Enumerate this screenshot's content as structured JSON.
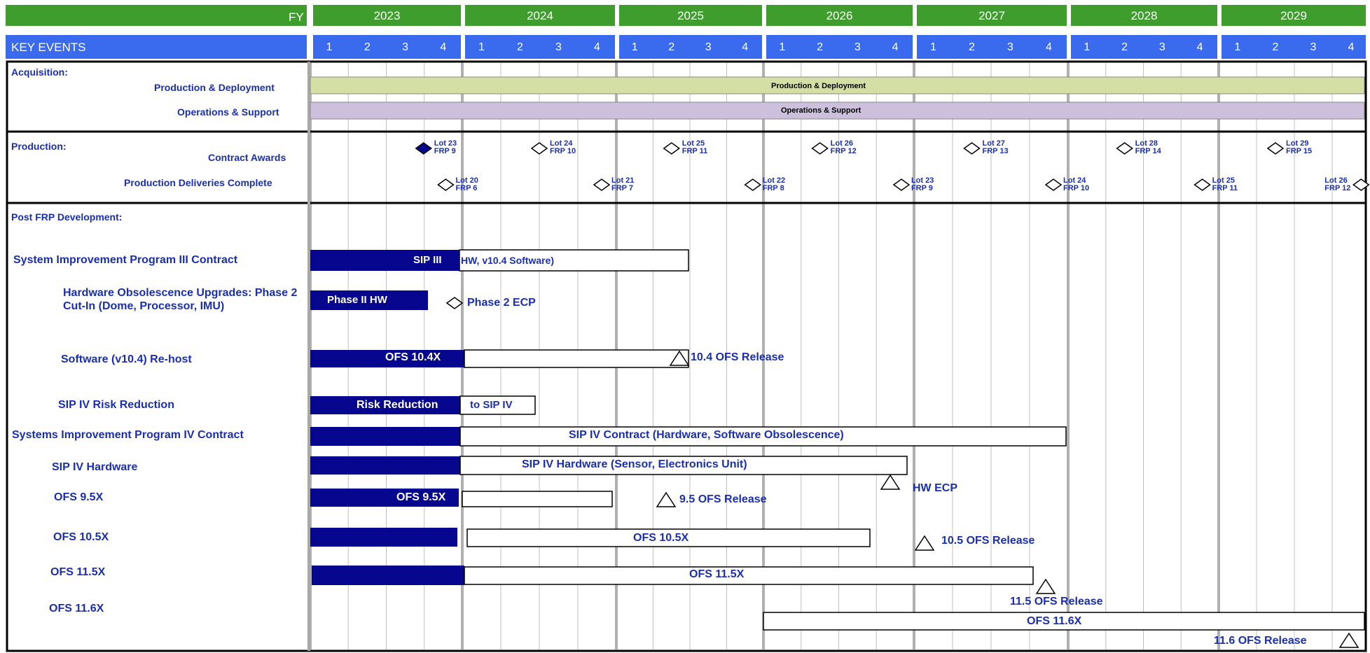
{
  "header": {
    "fy_label": "FY",
    "key_events_label": "KEY EVENTS",
    "years": [
      "2023",
      "2024",
      "2025",
      "2026",
      "2027",
      "2028",
      "2029"
    ],
    "quarters": [
      "1",
      "2",
      "3",
      "4"
    ]
  },
  "colors": {
    "header_green": "#3f9d2e",
    "header_blue": "#3a6bef",
    "navy": "#06068f",
    "text_blue": "#1a2fb0",
    "production_bar": "#d4dfa5",
    "ops_bar": "#ccc0dc",
    "grid_gray": "#c0c0c0"
  },
  "sections": {
    "acquisition": "Acquisition:",
    "production": "Production:",
    "post_frp": "Post FRP Development:"
  },
  "acquisition": {
    "production_deployment_label": "Production & Deployment",
    "production_deployment_bar": "Production & Deployment",
    "operations_support_label": "Operations & Support",
    "operations_support_bar": "Operations & Support"
  },
  "production": {
    "contract_awards_label": "Contract Awards",
    "deliveries_label": "Production Deliveries Complete",
    "awards": [
      {
        "lot": "Lot 23",
        "frp": "FRP 9",
        "filled": true
      },
      {
        "lot": "Lot 24",
        "frp": "FRP 10",
        "filled": false
      },
      {
        "lot": "Lot 25",
        "frp": "FRP 11",
        "filled": false
      },
      {
        "lot": "Lot 26",
        "frp": "FRP 12",
        "filled": false
      },
      {
        "lot": "Lot 27",
        "frp": "FRP 13",
        "filled": false
      },
      {
        "lot": "Lot 28",
        "frp": "FRP 14",
        "filled": false
      },
      {
        "lot": "Lot 29",
        "frp": "FRP 15",
        "filled": false
      }
    ],
    "deliveries": [
      {
        "lot": "Lot 20",
        "frp": "FRP 6"
      },
      {
        "lot": "Lot 21",
        "frp": "FRP 7"
      },
      {
        "lot": "Lot 22",
        "frp": "FRP 8"
      },
      {
        "lot": "Lot 23",
        "frp": "FRP 9"
      },
      {
        "lot": "Lot 24",
        "frp": "FRP 10"
      },
      {
        "lot": "Lot 25",
        "frp": "FRP 11"
      },
      {
        "lot": "Lot 26",
        "frp": "FRP 12"
      }
    ]
  },
  "rows": {
    "sip3_label": "System Improvement Program III Contract",
    "sip3_bar": "SIP III",
    "sip3_bar_rest": "HW, v10.4 Software)",
    "hw_obs_label": "Hardware Obsolescence Upgrades: Phase 2 Cut-In (Dome, Processor, IMU)",
    "hw_obs_bar": "Phase II HW",
    "hw_obs_milestone": "Phase 2 ECP",
    "sw_rehost_label": "Software (v10.4) Re-host",
    "sw_rehost_bar": "OFS 10.4X",
    "sw_rehost_milestone": "10.4 OFS Release",
    "sip4_risk_label": "SIP IV Risk Reduction",
    "sip4_risk_bar": "Risk Reduction",
    "sip4_risk_bar_rest": "to SIP IV",
    "sip4_contract_label": "Systems Improvement Program IV Contract",
    "sip4_contract_bar": "SIP IV Contract (Hardware, Software Obsolescence)",
    "sip4_hw_label": "SIP IV Hardware",
    "sip4_hw_bar": "SIP IV Hardware (Sensor, Electronics Unit)",
    "sip4_hw_milestone": "HW ECP",
    "ofs95_label": "OFS 9.5X",
    "ofs95_bar": "OFS 9.5X",
    "ofs95_milestone": "9.5 OFS Release",
    "ofs105_label": "OFS 10.5X",
    "ofs105_bar": "OFS 10.5X",
    "ofs105_milestone": "10.5 OFS Release",
    "ofs115_label": "OFS 11.5X",
    "ofs115_bar": "OFS 11.5X",
    "ofs115_milestone": "11.5 OFS Release",
    "ofs116_label": "OFS 11.6X",
    "ofs116_bar": "OFS 11.6X",
    "ofs116_milestone": "11.6 OFS Release"
  }
}
